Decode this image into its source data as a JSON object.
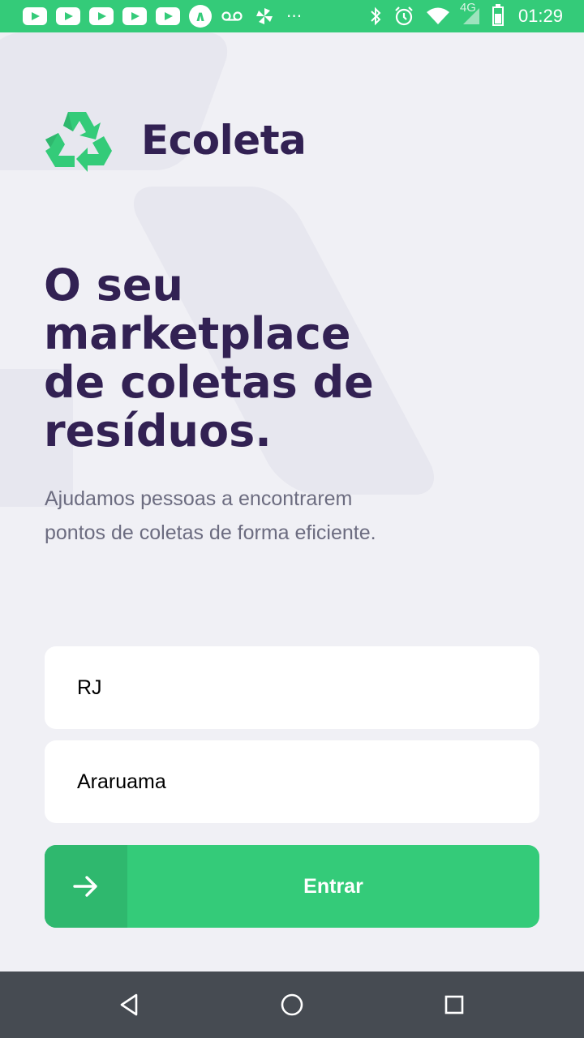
{
  "status_bar": {
    "time": "01:29",
    "network": "4G",
    "icons": [
      "youtube-icon",
      "youtube-icon",
      "youtube-icon",
      "youtube-icon",
      "youtube-icon",
      "app-a-icon",
      "voicemail-icon",
      "pinwheel-icon",
      "more-icon",
      "bluetooth-icon",
      "alarm-icon",
      "wifi-icon",
      "signal-icon",
      "battery-icon"
    ]
  },
  "app": {
    "name": "Ecoleta",
    "headline": "O seu marketplace de coletas de resíduos.",
    "description": "Ajudamos pessoas a encontrarem pontos de coletas de forma eficiente."
  },
  "form": {
    "uf_value": "RJ",
    "city_value": "Araruama",
    "enter_label": "Entrar"
  },
  "colors": {
    "primary": "#34cb79",
    "primary_dark": "#2fb86e",
    "title": "#322153",
    "text": "#6c6c80",
    "background": "#f0f0f5"
  },
  "navigation": [
    "back-icon",
    "home-icon",
    "recents-icon"
  ]
}
